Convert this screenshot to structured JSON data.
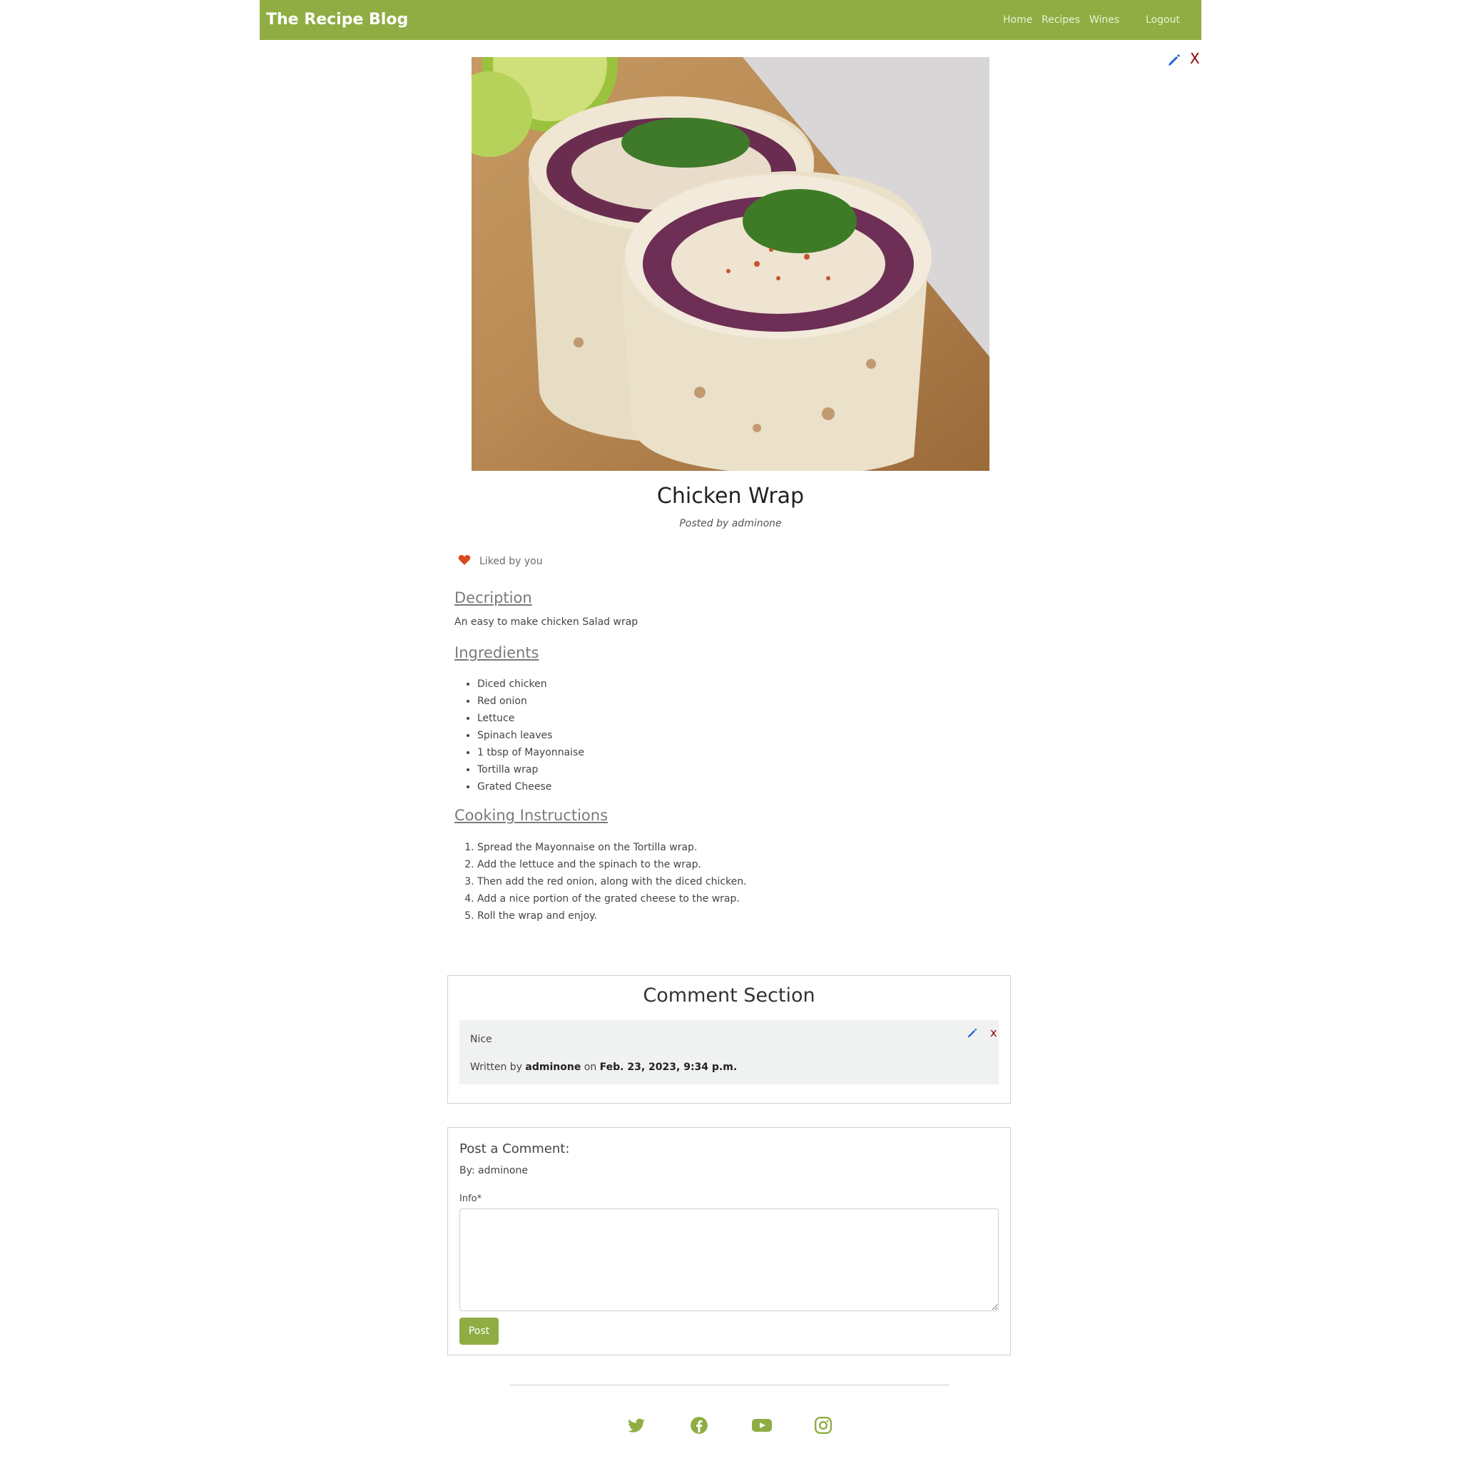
{
  "navbar": {
    "brand": "The Recipe Blog",
    "links": {
      "home": "Home",
      "recipes": "Recipes",
      "wines": "Wines",
      "logout": "Logout"
    },
    "bg_color": "#8fad43"
  },
  "recipe": {
    "title": "Chicken Wrap",
    "posted_by": "Posted by adminone",
    "liked_text": "Liked by you",
    "description_heading": "Decription",
    "description": "An easy to make chicken Salad wrap",
    "ingredients_heading": "Ingredients",
    "ingredients": [
      "Diced chicken",
      "Red onion",
      "Lettuce",
      "Spinach leaves",
      "1 tbsp of Mayonnaise",
      "Tortilla wrap",
      "Grated Cheese"
    ],
    "instructions_heading": "Cooking Instructions",
    "instructions": [
      "Spread the Mayonnaise on the Tortilla wrap.",
      "Add the lettuce and the spinach to the wrap.",
      "Then add the red onion, along with the diced chicken.",
      "Add a nice portion of the grated cheese to the wrap.",
      "Roll the wrap and enjoy."
    ],
    "delete_glyph": "X"
  },
  "comments": {
    "title": "Comment Section",
    "items": [
      {
        "body": "Nice",
        "written_by_prefix": "Written by",
        "author": "adminone",
        "on": "on",
        "date": "Feb. 23, 2023, 9:34 p.m.",
        "delete_glyph": "x"
      }
    ]
  },
  "post_form": {
    "title": "Post a Comment:",
    "by": "By: adminone",
    "info_label": "Info*",
    "info_value": "",
    "button": "Post"
  },
  "footer": {
    "icons": [
      "twitter-icon",
      "facebook-icon",
      "youtube-icon",
      "instagram-icon"
    ]
  },
  "colors": {
    "accent": "#8fad43",
    "delete": "#8b0000",
    "edit": "#1a5fd1",
    "heart": "#d94a1e"
  }
}
